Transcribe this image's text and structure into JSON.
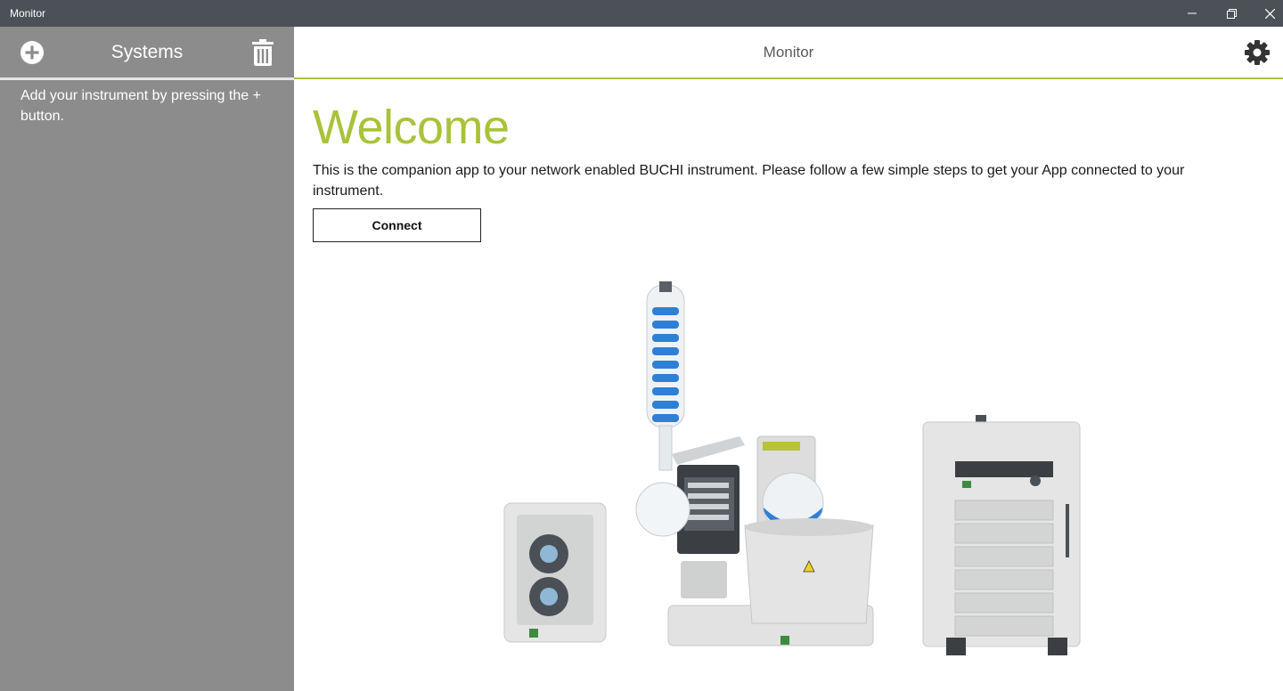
{
  "window": {
    "title": "Monitor"
  },
  "sidebar": {
    "heading": "Systems",
    "empty_message": "Add your instrument by pressing the + button."
  },
  "header": {
    "title": "Monitor"
  },
  "main": {
    "welcome_heading": "Welcome",
    "intro_text": "This is the companion app to your network enabled BUCHI instrument. Please follow a few simple steps to get your App connected to your instrument.",
    "connect_label": "Connect"
  },
  "icons": {
    "add": "plus-circle-icon",
    "delete": "trash-icon",
    "settings": "gear-icon",
    "minimize": "minimize-icon",
    "restore": "restore-icon",
    "close": "close-icon"
  },
  "colors": {
    "accent": "#a8c33a",
    "titlebar": "#4b5157",
    "sidebar": "#8c8c8c"
  }
}
